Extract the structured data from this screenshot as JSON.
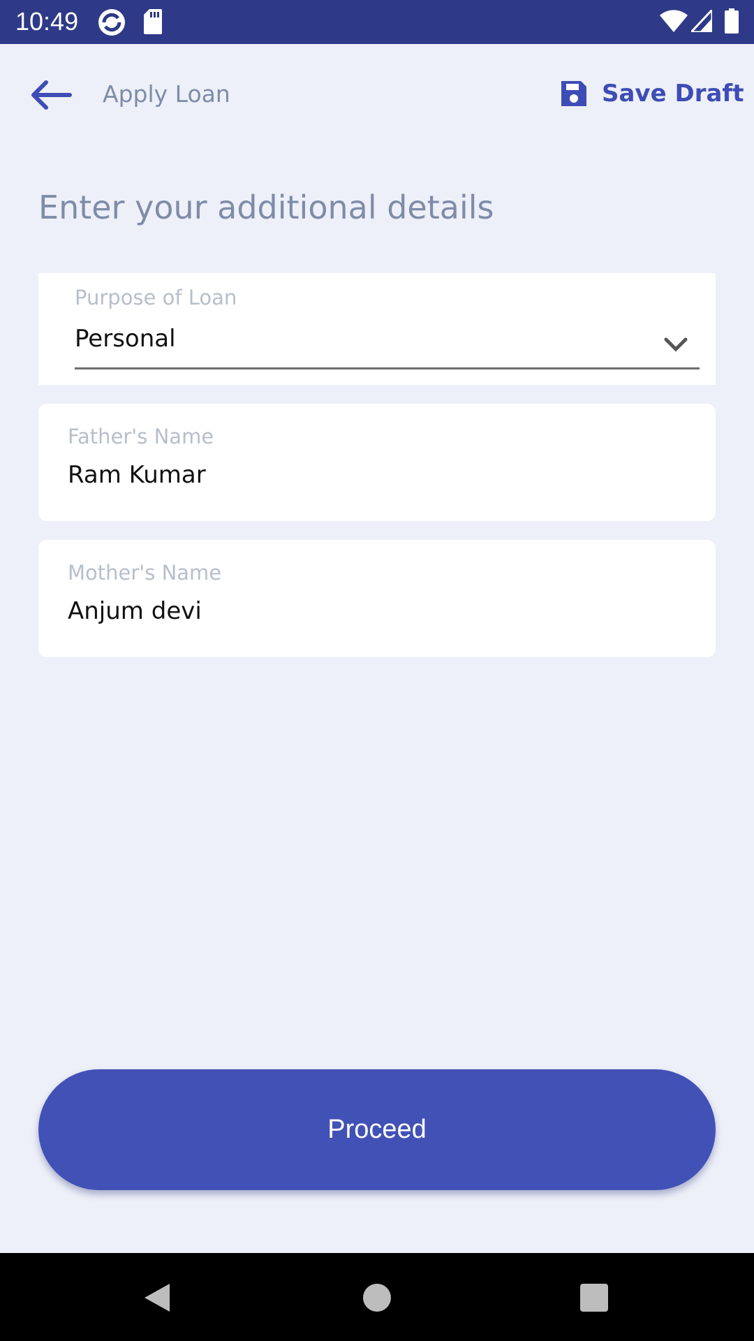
{
  "status_bar": {
    "time": "10:49",
    "icons": [
      "sync-icon",
      "sd-card-icon",
      "wifi-icon",
      "signal-icon",
      "battery-icon"
    ]
  },
  "header": {
    "title": "Apply Loan",
    "save_draft_label": "Save Draft",
    "icons": [
      "back-arrow-icon",
      "save-icon"
    ]
  },
  "page": {
    "heading": "Enter your additional details"
  },
  "form": {
    "purpose": {
      "label": "Purpose of Loan",
      "value": "Personal"
    },
    "father": {
      "label": "Father's Name",
      "value": "Ram Kumar"
    },
    "mother": {
      "label": "Mother's Name",
      "value": "Anjum devi"
    }
  },
  "actions": {
    "proceed_label": "Proceed"
  },
  "nav_bar": {
    "icons": [
      "nav-back-icon",
      "nav-home-icon",
      "nav-recents-icon"
    ]
  },
  "colors": {
    "status_bar": "#2E3A87",
    "background": "#EDF0F8",
    "accent": "#3E4DB5",
    "button": "#4151B6",
    "muted_text": "#7F8CA8"
  }
}
